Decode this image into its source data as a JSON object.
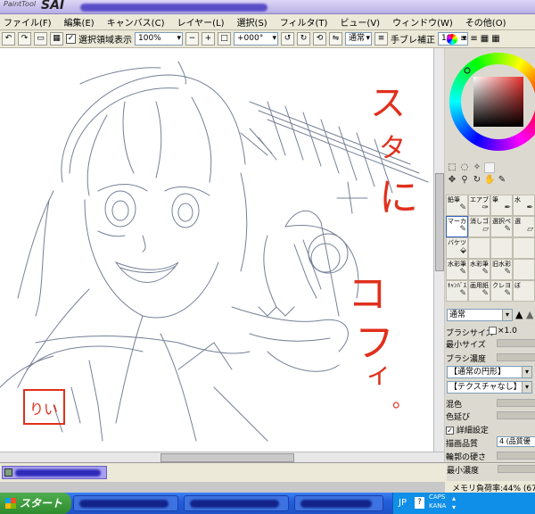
{
  "title": {
    "brand_small": "PaintTool",
    "brand_big": "SAI"
  },
  "menu": [
    "ファイル(F)",
    "編集(E)",
    "キャンバス(C)",
    "レイヤー(L)",
    "選択(S)",
    "フィルタ(T)",
    "ビュー(V)",
    "ウィンドウ(W)",
    "その他(O)"
  ],
  "toolbar": {
    "show_selection_label": "選択領域表示",
    "zoom_value": "100%",
    "rotation_value": "+000°",
    "blend_label": "通常",
    "stabilizer_label": "手ブレ補正",
    "stabilizer_value": "10"
  },
  "canvas": {
    "handwriting": [
      "ス",
      "タ",
      "に",
      "コ",
      "フ",
      "ィ",
      "。"
    ],
    "signature": "りい"
  },
  "tools": [
    {
      "label": "鉛筆",
      "sel": false
    },
    {
      "label": "エアブラシ",
      "sel": false
    },
    {
      "label": "筆",
      "sel": false
    },
    {
      "label": "水",
      "sel": false
    },
    {
      "label": "マーカー",
      "sel": true
    },
    {
      "label": "消しゴム",
      "sel": false
    },
    {
      "label": "選択ペン",
      "sel": false
    },
    {
      "label": "選",
      "sel": false
    },
    {
      "label": "バケツ",
      "sel": false
    },
    {
      "label": "",
      "sel": false
    },
    {
      "label": "",
      "sel": false
    },
    {
      "label": "",
      "sel": false
    },
    {
      "label": "水彩筆 9縁",
      "sel": false
    },
    {
      "label": "水彩筆 10縁",
      "sel": false
    },
    {
      "label": "旧水彩",
      "sel": false
    },
    {
      "label": "",
      "sel": false
    },
    {
      "label": "ｷｬﾝﾊﾞｽ ｱｸﾘﾙ",
      "sel": false
    },
    {
      "label": "画用紙 ｱｸﾘﾙ",
      "sel": false
    },
    {
      "label": "クレヨン",
      "sel": false
    },
    {
      "label": "ぼ",
      "sel": false
    }
  ],
  "brush": {
    "mode": "通常",
    "size_label": "ブラシサイズ",
    "size_mult": "×1.0",
    "min_size_label": "最小サイズ",
    "density_label": "ブラシ濃度",
    "shape": "【通常の円形】",
    "texture": "【テクスチャなし】",
    "mix_label": "混色",
    "stretch_label": "色延び",
    "detail_label": "詳細設定",
    "quality_label": "描画品質",
    "quality_value": "4 (品質優",
    "edge_label": "輪郭の硬さ",
    "min_density_label": "最小濃度"
  },
  "status": {
    "memory": "メモリ負荷率:44% (67MB使"
  },
  "taskbar": {
    "start": "スタート",
    "lang": "JP",
    "caps": "CAPS",
    "kana": "KANA"
  }
}
